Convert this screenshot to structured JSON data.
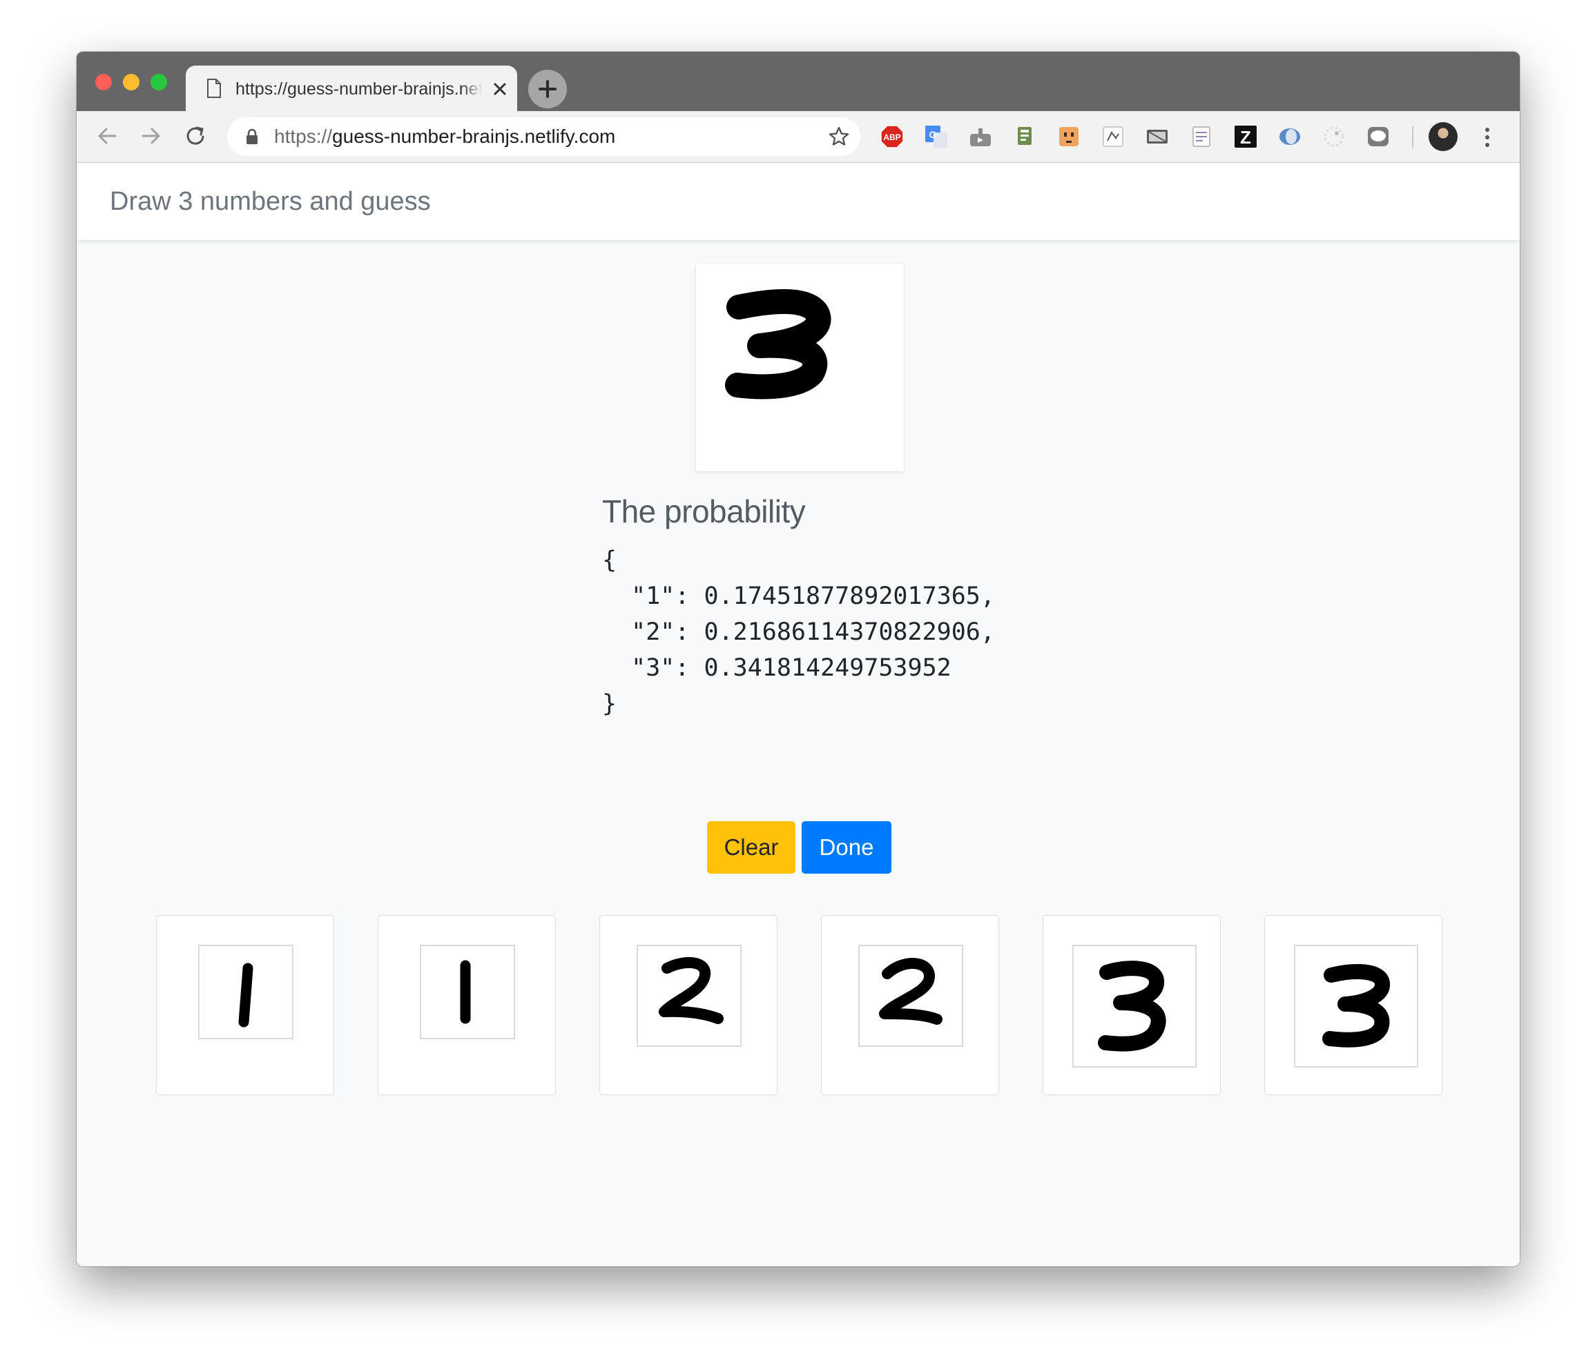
{
  "browser": {
    "tab_title": "https://guess-number-brainjs.netlify.com",
    "url_scheme": "https://",
    "url_host": "guess-number-brainjs.netlify.com",
    "extensions": [
      "abp-icon",
      "translate-icon",
      "extension-icon",
      "extension-icon",
      "extension-icon",
      "extension-icon",
      "extension-icon",
      "extension-icon",
      "zotero-icon",
      "extension-icon",
      "extension-icon",
      "line-icon"
    ],
    "extension_labels": {
      "abp": "ABP",
      "zotero": "Z"
    }
  },
  "page": {
    "brand": "Draw 3 numbers and guess",
    "probability_title": "The probability",
    "probability_lines": [
      "{",
      "  \"1\": 0.17451877892017365,",
      "  \"2\": 0.21686114370822906,",
      "  \"3\": 0.341814249753952",
      "}"
    ],
    "buttons": {
      "clear": "Clear",
      "done": "Done"
    },
    "canvas_digit": "3",
    "samples": [
      "1",
      "1",
      "2",
      "2",
      "3",
      "3"
    ]
  },
  "colors": {
    "warning": "#ffc107",
    "primary": "#007bff",
    "tabstrip": "#666666"
  }
}
